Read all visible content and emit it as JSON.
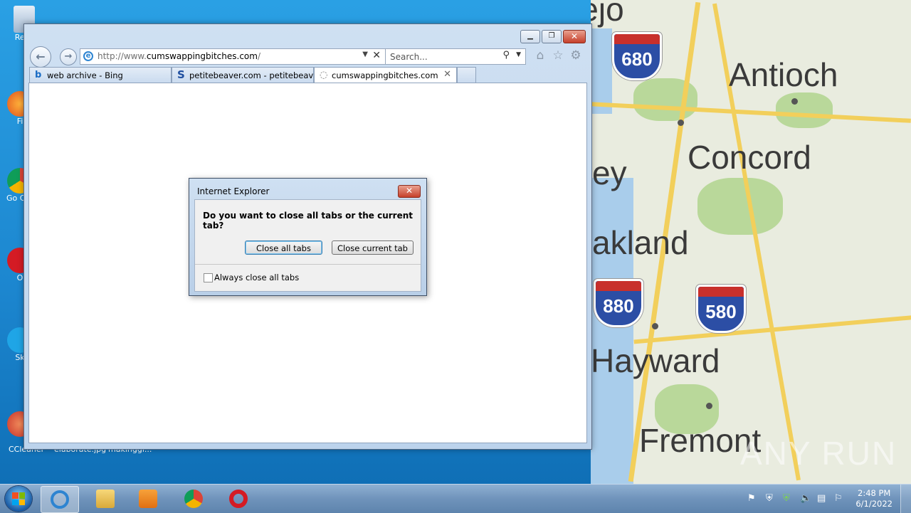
{
  "desktop": {
    "icons": [
      {
        "label": "Recy",
        "name": "recycle-bin"
      },
      {
        "label": "Fi",
        "name": "firefox"
      },
      {
        "label": "Go Chr",
        "name": "google-chrome"
      },
      {
        "label": "O",
        "name": "opera"
      },
      {
        "label": "Sk",
        "name": "skype"
      },
      {
        "label": "CCleaner",
        "name": "ccleaner"
      }
    ],
    "bottom_labels": [
      "CCleaner",
      "elaborate.jpg",
      "makinggl..."
    ],
    "map": {
      "cities": [
        "Vallejo",
        "Antioch",
        "Concord",
        "ey",
        "akland",
        "Hayward",
        "Fremont"
      ],
      "shields": [
        "680",
        "880",
        "580"
      ]
    },
    "watermark": "ANY RUN"
  },
  "browser": {
    "window_buttons": {
      "minimize": "minimize",
      "restore": "restore",
      "close": "close"
    },
    "address": {
      "prefix": "http://www.",
      "domain": "cumswappingbitches.com",
      "suffix": "/"
    },
    "search": {
      "placeholder": "Search..."
    },
    "tabs": [
      {
        "title": "web archive - Bing",
        "favicon": "b",
        "active": false
      },
      {
        "title": "petitebeaver.com - petitebeav...",
        "favicon": "S",
        "active": false
      },
      {
        "title": "cumswappingbitches.com",
        "favicon": "loading",
        "active": true
      }
    ]
  },
  "dialog": {
    "title": "Internet Explorer",
    "close_glyph": "✕",
    "question": "Do you want to close all tabs or the current tab?",
    "close_all_label": "Close all tabs",
    "close_current_label": "Close current tab",
    "always_close_label": "Always close all tabs",
    "always_close_checked": false
  },
  "taskbar": {
    "pinned": [
      "internet-explorer",
      "file-explorer",
      "media-player",
      "google-chrome",
      "opera"
    ],
    "clock_time": "2:48 PM",
    "clock_date": "6/1/2022"
  }
}
